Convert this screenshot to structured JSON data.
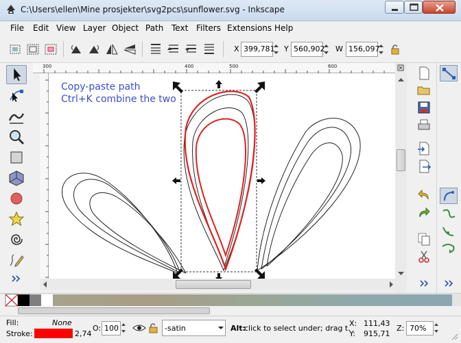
{
  "window": {
    "title": "C:\\Users\\ellen\\Mine prosjekter\\svg2pcs\\sunflower.svg - Inkscape"
  },
  "menu": [
    "File",
    "Edit",
    "View",
    "Layer",
    "Object",
    "Path",
    "Text",
    "Filters",
    "Extensions",
    "Help"
  ],
  "toolbar": {
    "x_label": "X",
    "x_value": "399,781",
    "y_label": "Y",
    "y_value": "560,902",
    "w_label": "W",
    "w_value": "156,097"
  },
  "ruler": {
    "h_labels": [
      "300",
      "400",
      "500",
      "600"
    ]
  },
  "canvas": {
    "note_line1": "Copy-paste path",
    "note_line2": "Ctrl+K combine the two",
    "note_color": "#3a4fd0",
    "path_red": "#e02020"
  },
  "status": {
    "fill_label": "Fill:",
    "fill_value": "None",
    "stroke_label": "Stroke:",
    "stroke_width": "2,74",
    "stroke_color": "#ff0000",
    "opacity_label": "O:",
    "opacity_value": "100",
    "layer_name": "-satin",
    "message_bold": "Alt:",
    "message": " click to select under; drag t.",
    "x_coord_label": "X:",
    "x_coord": "111,43",
    "y_coord_label": "Y:",
    "y_coord": "915,71",
    "zoom_label": "Z:",
    "zoom_value": "70%"
  }
}
